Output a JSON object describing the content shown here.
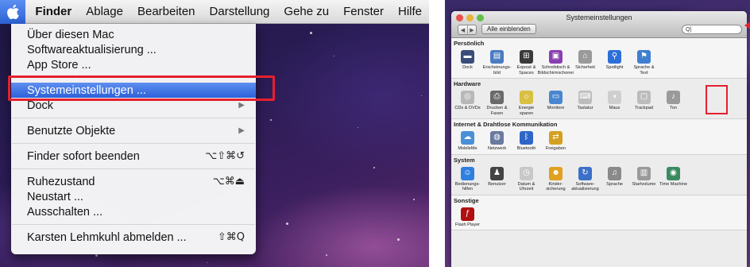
{
  "menubar": {
    "apple_icon": "apple-icon",
    "items": [
      "Finder",
      "Ablage",
      "Bearbeiten",
      "Darstellung",
      "Gehe zu",
      "Fenster",
      "Hilfe"
    ]
  },
  "apple_menu": {
    "about": "Über diesen Mac",
    "software_update": "Softwareaktualisierung ...",
    "app_store": "App Store ...",
    "system_prefs": "Systemeinstellungen ...",
    "dock": "Dock",
    "recent_items": "Benutzte Objekte",
    "force_quit": "Finder sofort beenden",
    "force_quit_shortcut": "⌥⇧⌘↺",
    "sleep": "Ruhezustand",
    "sleep_shortcut": "⌥⌘⏏",
    "restart": "Neustart ...",
    "shutdown": "Ausschalten ...",
    "logout": "Karsten Lehmkuhl abmelden ...",
    "logout_shortcut": "⇧⌘Q"
  },
  "syspref": {
    "title": "Systemeinstellungen",
    "show_all": "Alle einblenden",
    "search_value": "Q|",
    "sections": {
      "personal": {
        "title": "Persönlich",
        "items": [
          {
            "label": "Dock",
            "icon": "dock-icon"
          },
          {
            "label": "Erscheinungs-\nbild",
            "icon": "appearance-icon"
          },
          {
            "label": "Exposé &\nSpaces",
            "icon": "expose-icon"
          },
          {
            "label": "Schreibtisch &\nBildschirmschoner",
            "icon": "desktop-icon"
          },
          {
            "label": "Sicherheit",
            "icon": "security-icon"
          },
          {
            "label": "Spotlight",
            "icon": "spotlight-icon"
          },
          {
            "label": "Sprache &\nText",
            "icon": "language-icon"
          }
        ]
      },
      "hardware": {
        "title": "Hardware",
        "items": [
          {
            "label": "CDs & DVDs",
            "icon": "cd-icon"
          },
          {
            "label": "Drucken &\nFaxen",
            "icon": "printer-icon"
          },
          {
            "label": "Energie\nsparen",
            "icon": "energy-icon"
          },
          {
            "label": "Monitore",
            "icon": "monitor-icon"
          },
          {
            "label": "Tastatur",
            "icon": "keyboard-icon"
          },
          {
            "label": "Maus",
            "icon": "mouse-icon"
          },
          {
            "label": "Trackpad",
            "icon": "trackpad-icon"
          },
          {
            "label": "Ton",
            "icon": "sound-icon"
          }
        ]
      },
      "internet": {
        "title": "Internet & Drahtlose Kommunikation",
        "items": [
          {
            "label": "MobileMe",
            "icon": "mobileme-icon"
          },
          {
            "label": "Netzwerk",
            "icon": "network-icon"
          },
          {
            "label": "Bluetooth",
            "icon": "bluetooth-icon"
          },
          {
            "label": "Freigaben",
            "icon": "sharing-icon"
          }
        ]
      },
      "system": {
        "title": "System",
        "items": [
          {
            "label": "Bedienungs-\nhilfen",
            "icon": "accessibility-icon"
          },
          {
            "label": "Benutzer",
            "icon": "users-icon"
          },
          {
            "label": "Datum &\nUhrzeit",
            "icon": "clock-icon"
          },
          {
            "label": "Kinder-\nsicherung",
            "icon": "parental-icon"
          },
          {
            "label": "Software-\naktualisierung",
            "icon": "update-icon"
          },
          {
            "label": "Sprache",
            "icon": "speech-icon"
          },
          {
            "label": "Startvolume",
            "icon": "startup-disk-icon"
          },
          {
            "label": "Time Machine",
            "icon": "timemachine-icon"
          }
        ]
      },
      "other": {
        "title": "Sonstige",
        "items": [
          {
            "label": "Flash Player",
            "icon": "flash-icon"
          }
        ]
      }
    }
  },
  "colors": {
    "highlight": "#3a6fe0",
    "annotation_red": "#e6202e"
  }
}
